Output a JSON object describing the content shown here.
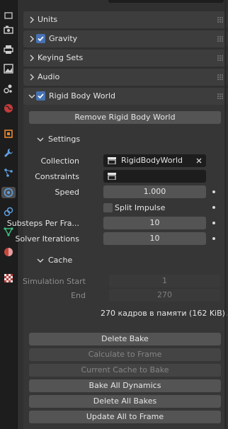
{
  "sidebar": {
    "tabs": [
      {
        "name": "tool-tab",
        "icon": "tool-icon"
      },
      {
        "name": "render-tab",
        "icon": "render-icon"
      },
      {
        "name": "output-tab",
        "icon": "printer-icon"
      },
      {
        "name": "view-layer-tab",
        "icon": "image-icon"
      },
      {
        "name": "scene-tab",
        "icon": "scene-icon"
      },
      {
        "name": "world-tab",
        "icon": "world-icon"
      },
      {
        "name": "object-tab",
        "icon": "object-icon"
      },
      {
        "name": "modifiers-tab",
        "icon": "wrench-icon"
      },
      {
        "name": "particles-tab",
        "icon": "particles-icon"
      },
      {
        "name": "physics-tab",
        "icon": "physics-icon"
      },
      {
        "name": "constraints-tab",
        "icon": "constraint-icon"
      },
      {
        "name": "data-tab",
        "icon": "mesh-data-icon"
      },
      {
        "name": "material-tab",
        "icon": "material-icon"
      },
      {
        "name": "texture-tab",
        "icon": "texture-icon"
      }
    ],
    "accent_active": "#4d4d4d"
  },
  "panels": {
    "units": "Units",
    "gravity": "Gravity",
    "keying_sets": "Keying Sets",
    "audio": "Audio",
    "rigid_body_world": "Rigid Body World"
  },
  "rbw": {
    "remove_button": "Remove Rigid Body World",
    "settings_header": "Settings",
    "collection_label": "Collection",
    "collection_value": "RigidBodyWorld",
    "constraints_label": "Constraints",
    "constraints_value": "",
    "speed_label": "Speed",
    "speed_value": "1.000",
    "split_impulse_label": "Split Impulse",
    "substeps_label": "Substeps Per Fra...",
    "substeps_value": "10",
    "solver_label": "Solver Iterations",
    "solver_value": "10",
    "cache_header": "Cache",
    "sim_start_label": "Simulation Start",
    "sim_start_value": "1",
    "end_label": "End",
    "end_value": "270",
    "cache_info": "270 кадров в памяти (162 KiB).",
    "delete_bake": "Delete Bake",
    "calculate_to_frame": "Calculate to Frame",
    "current_cache_to_bake": "Current Cache to Bake",
    "bake_all_dynamics": "Bake All Dynamics",
    "delete_all_bakes": "Delete All Bakes",
    "update_all_to_frame": "Update All to Frame"
  },
  "colors": {
    "checkbox_blue": "#4772b3",
    "background": "#303030",
    "sidebar": "#1d1d1d"
  }
}
